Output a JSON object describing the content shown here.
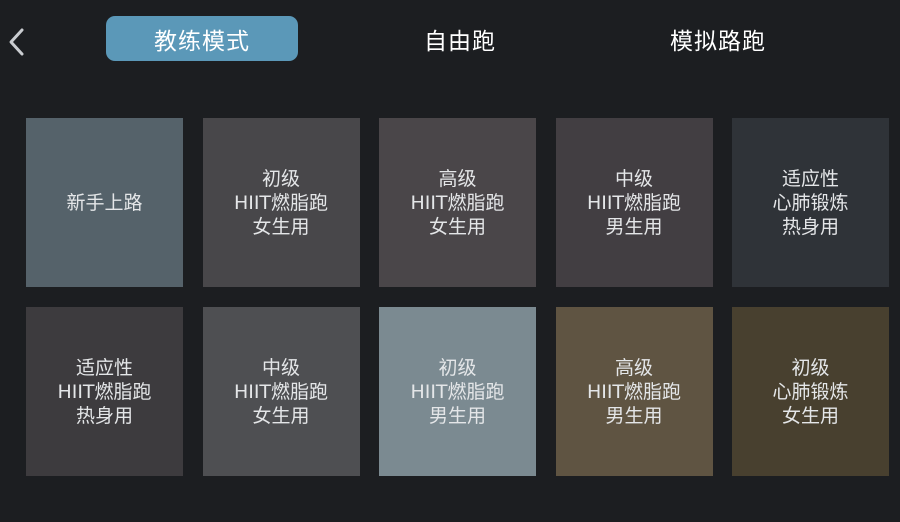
{
  "header": {
    "tabs": [
      {
        "label": "教练模式",
        "active": true
      },
      {
        "label": "自由跑",
        "active": false
      },
      {
        "label": "模拟路跑",
        "active": false
      }
    ]
  },
  "colors": {
    "background": "#1c1e21",
    "active_tab": "#5b98b8",
    "back_icon": "#c9ccd0"
  },
  "programs": [
    {
      "lines": [
        "新手上路",
        "",
        ""
      ],
      "color": "#55626a"
    },
    {
      "lines": [
        "初级",
        "HIIT燃脂跑",
        "女生用"
      ],
      "color": "#48474a"
    },
    {
      "lines": [
        "高级",
        "HIIT燃脂跑",
        "女生用"
      ],
      "color": "#4a4649"
    },
    {
      "lines": [
        "中级",
        "HIIT燃脂跑",
        "男生用"
      ],
      "color": "#423e42"
    },
    {
      "lines": [
        "适应性",
        "心肺锻炼",
        "热身用"
      ],
      "color": "#2f3338"
    },
    {
      "lines": [
        "适应性",
        "HIIT燃脂跑",
        "热身用"
      ],
      "color": "#3d3b3e"
    },
    {
      "lines": [
        "中级",
        "HIIT燃脂跑",
        "女生用"
      ],
      "color": "#4e4f52"
    },
    {
      "lines": [
        "初级",
        "HIIT燃脂跑",
        "男生用"
      ],
      "color": "#7b8a91"
    },
    {
      "lines": [
        "高级",
        "HIIT燃脂跑",
        "男生用"
      ],
      "color": "#5f5442"
    },
    {
      "lines": [
        "初级",
        "心肺锻炼",
        "女生用"
      ],
      "color": "#48402f"
    }
  ]
}
